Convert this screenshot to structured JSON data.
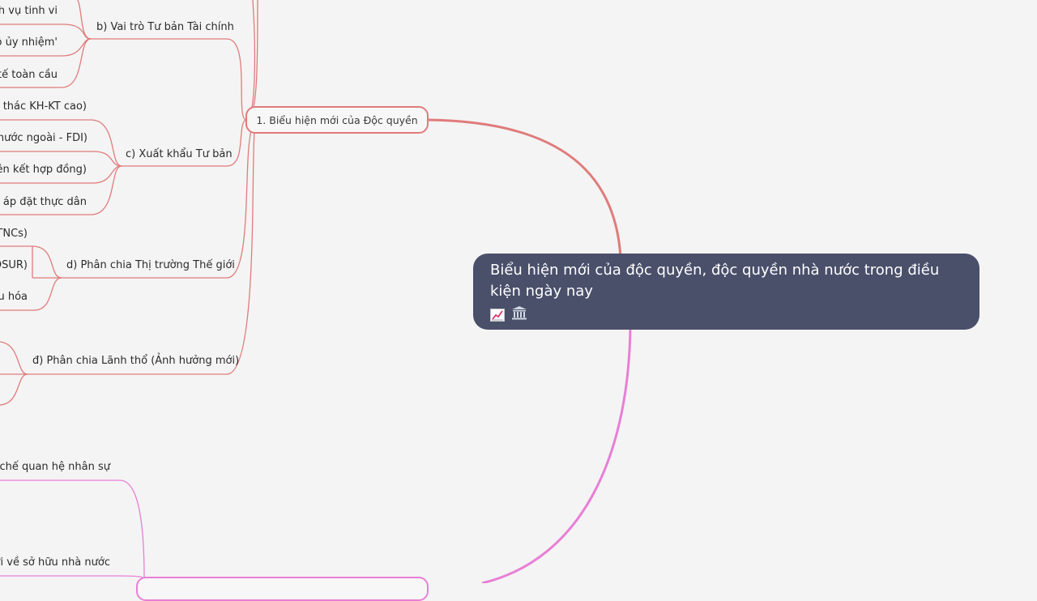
{
  "colors": {
    "background": "#f4f4f4",
    "root_fill": "#4a4f6a",
    "branch1_color": "#e07b7b",
    "branch2_color": "#e87fd6"
  },
  "root": {
    "title": "Biểu hiện mới của độc quyền, độc quyền nhà nước trong điều kiện ngày nay",
    "icons": [
      "chart-increasing-icon",
      "classical-building-icon"
    ]
  },
  "branch1": {
    "title": "1. Biểu hiện mới của Độc quyền",
    "sub_b": {
      "title": "b) Vai trò Tư bản Tài chính",
      "leaves": [
        "ch vụ tinh vi",
        "độ ủy nhiệm'",
        "tế toàn cầu"
      ]
    },
    "sub_c": {
      "title": "c) Xuất khẩu Tư bản",
      "leaves": [
        "ai thác KH-KT cao)",
        "o nước ngoài - FDI)",
        "liên kết hợp đồng)",
        "hế áp đặt thực dân"
      ]
    },
    "sub_d": {
      "title": "d) Phân chia Thị trường Thế giới",
      "leaves": [
        "TNCs)",
        "OSUR)",
        "u hóa"
      ]
    },
    "sub_dd": {
      "title": "đ) Phân chia Lãnh thổ (Ảnh hưởng mới)"
    }
  },
  "branch2": {
    "leaves": [
      "cơ chế quan hệ nhân sự",
      "mới về sở hữu nhà nước"
    ]
  }
}
